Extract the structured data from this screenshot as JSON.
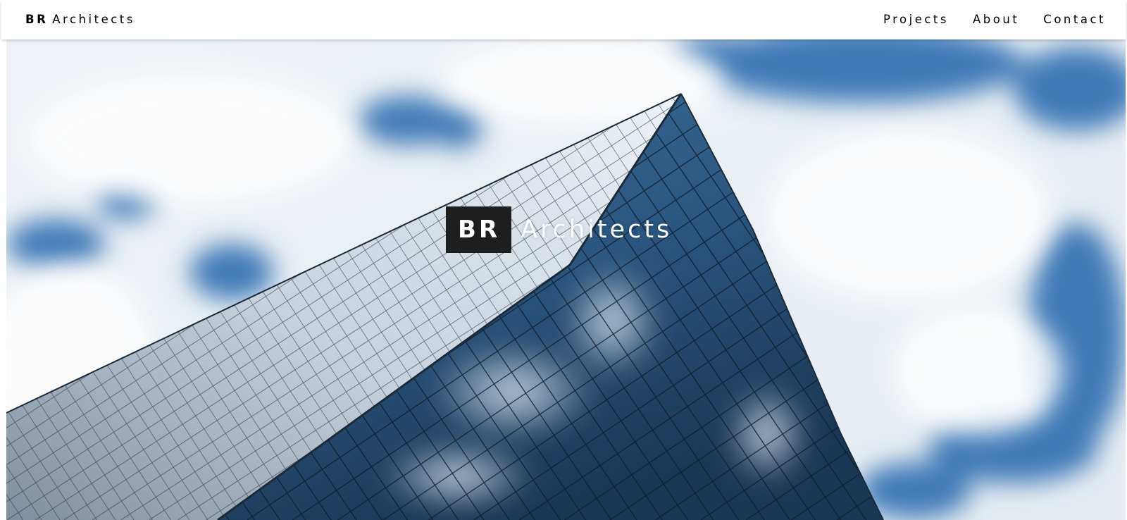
{
  "header": {
    "brand_mark": "BR",
    "brand_name": "Architects",
    "nav": {
      "projects": "Projects",
      "about": "About",
      "contact": "Contact"
    }
  },
  "hero": {
    "badge": "BR",
    "title": "Architects",
    "image_subject": "glass-skyscraper-against-cloudy-sky",
    "colors": {
      "sky_blue": "#3a78b8",
      "cloud_white": "#f2f4f7",
      "glass_dark": "#1f3e5d",
      "glass_light": "#7fa3c3"
    }
  }
}
